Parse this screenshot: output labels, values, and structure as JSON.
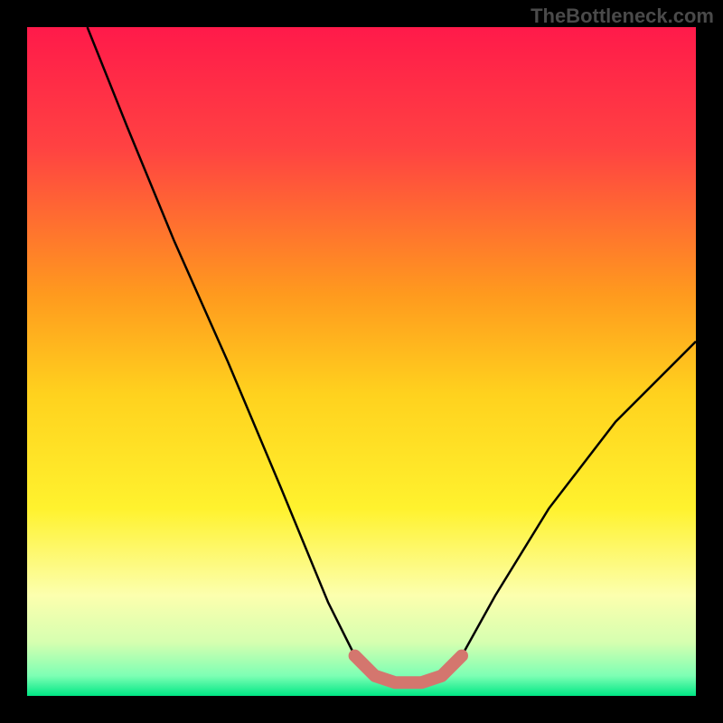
{
  "watermark": "TheBottleneck.com",
  "chart_data": {
    "type": "line",
    "title": "",
    "xlabel": "",
    "ylabel": "",
    "xlim": [
      0,
      100
    ],
    "ylim": [
      0,
      100
    ],
    "gradient_stops": [
      {
        "offset": 0,
        "color": "#ff1a4a"
      },
      {
        "offset": 0.18,
        "color": "#ff4242"
      },
      {
        "offset": 0.4,
        "color": "#ff9a1e"
      },
      {
        "offset": 0.55,
        "color": "#ffd21e"
      },
      {
        "offset": 0.72,
        "color": "#fff22e"
      },
      {
        "offset": 0.85,
        "color": "#fcffae"
      },
      {
        "offset": 0.92,
        "color": "#d6ffb0"
      },
      {
        "offset": 0.97,
        "color": "#7dffb4"
      },
      {
        "offset": 1.0,
        "color": "#00e785"
      }
    ],
    "curve_points": [
      {
        "x": 9,
        "y": 100
      },
      {
        "x": 15,
        "y": 85
      },
      {
        "x": 22,
        "y": 68
      },
      {
        "x": 30,
        "y": 50
      },
      {
        "x": 38,
        "y": 31
      },
      {
        "x": 45,
        "y": 14
      },
      {
        "x": 49,
        "y": 6
      },
      {
        "x": 52,
        "y": 3
      },
      {
        "x": 55,
        "y": 2
      },
      {
        "x": 59,
        "y": 2
      },
      {
        "x": 62,
        "y": 3
      },
      {
        "x": 65,
        "y": 6
      },
      {
        "x": 70,
        "y": 15
      },
      {
        "x": 78,
        "y": 28
      },
      {
        "x": 88,
        "y": 41
      },
      {
        "x": 100,
        "y": 53
      }
    ],
    "highlight_segment": {
      "color": "#d4766e",
      "points": [
        {
          "x": 49,
          "y": 6
        },
        {
          "x": 52,
          "y": 3
        },
        {
          "x": 55,
          "y": 2
        },
        {
          "x": 59,
          "y": 2
        },
        {
          "x": 62,
          "y": 3
        },
        {
          "x": 65,
          "y": 6
        }
      ]
    }
  }
}
